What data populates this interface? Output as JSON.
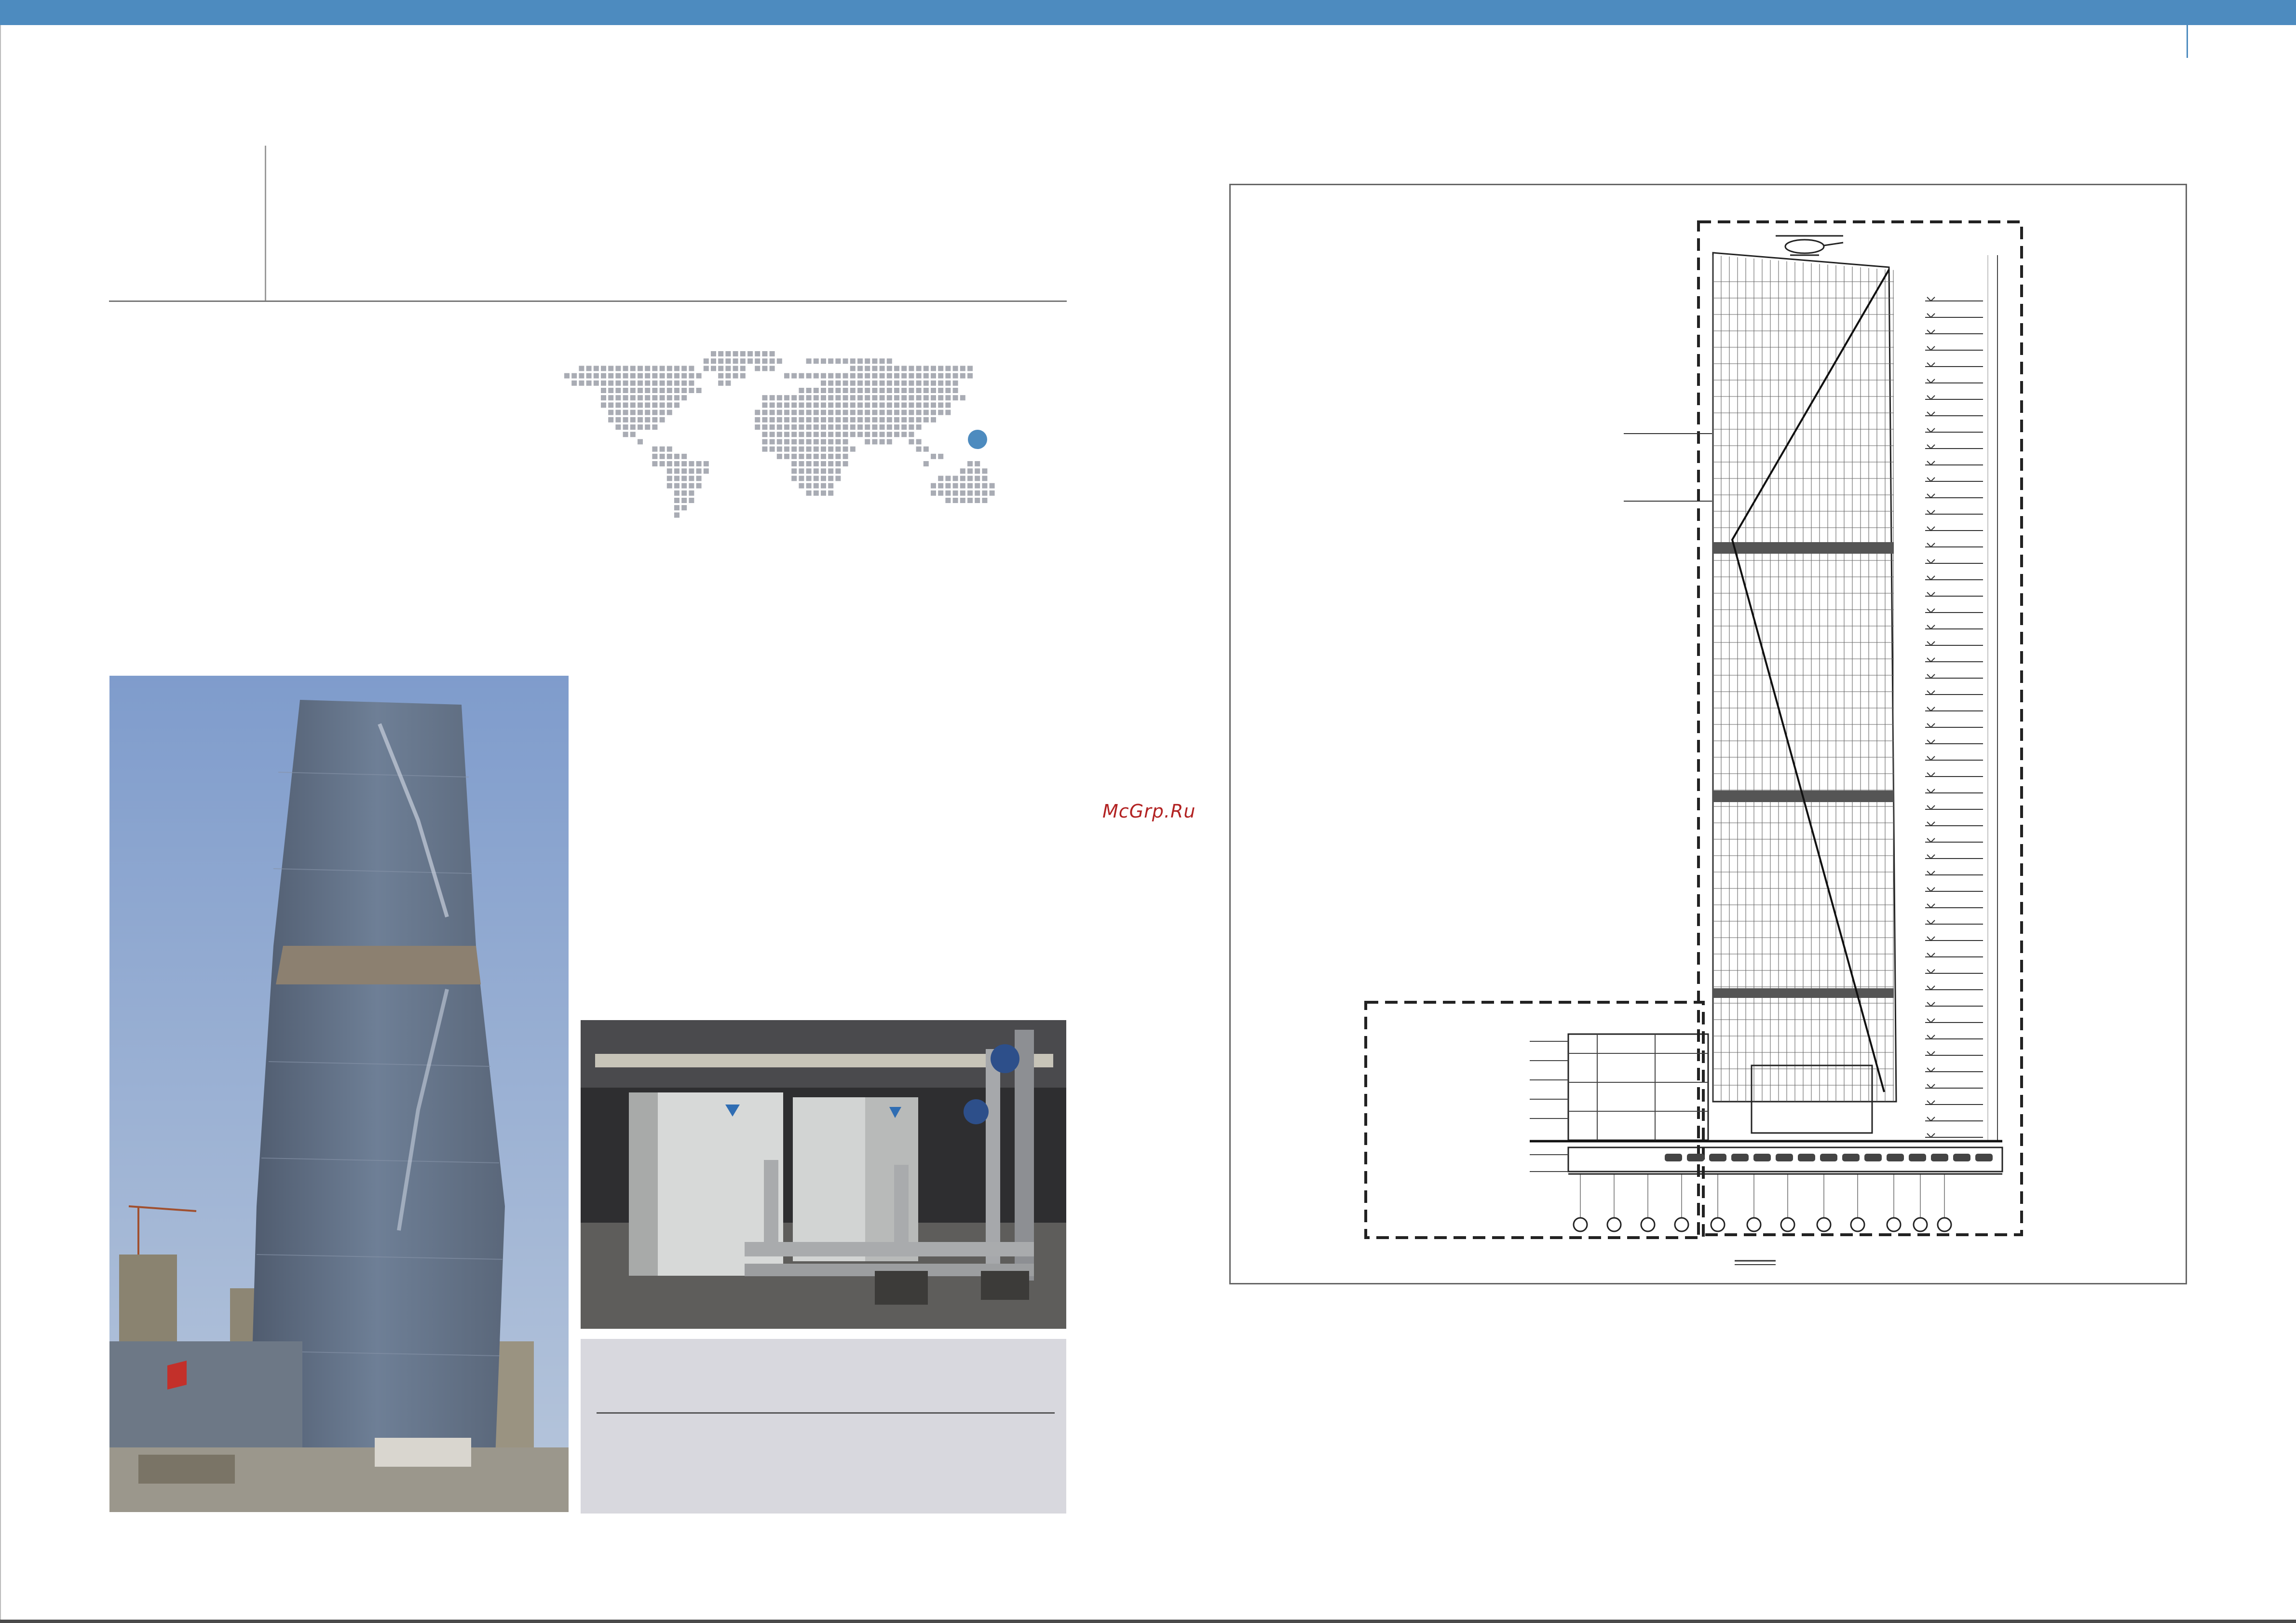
{
  "watermark": {
    "text": "McGrp.Ru"
  },
  "colors": {
    "accent": "#4d8bbf",
    "map_dot": "#a9acb4",
    "map_marker": "#4d8bbf",
    "caption_bg": "#d8d8de"
  },
  "icons": {
    "helicopter": "helicopter-icon"
  }
}
